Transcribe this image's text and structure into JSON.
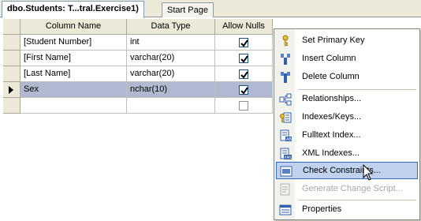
{
  "tabs": [
    {
      "label": "dbo.Students: T...tral.Exercise1)"
    },
    {
      "label": "Start Page"
    }
  ],
  "grid": {
    "headers": {
      "name": "Column Name",
      "type": "Data Type",
      "nulls": "Allow Nulls"
    },
    "rows": [
      {
        "name": "[Student Number]",
        "type": "int",
        "allow_nulls": true
      },
      {
        "name": "[First Name]",
        "type": "varchar(20)",
        "allow_nulls": true
      },
      {
        "name": "[Last Name]",
        "type": "varchar(20)",
        "allow_nulls": true
      },
      {
        "name": "Sex",
        "type": "nchar(10)",
        "allow_nulls": true,
        "selected": true
      },
      {
        "name": "",
        "type": "",
        "allow_nulls": false
      }
    ]
  },
  "menu": {
    "items": [
      {
        "label": "Set Primary Key",
        "icon": "key-icon"
      },
      {
        "label": "Insert Column",
        "icon": "insert-column-icon"
      },
      {
        "label": "Delete Column",
        "icon": "delete-column-icon"
      },
      {
        "label": "Relationships...",
        "icon": "relationships-icon"
      },
      {
        "label": "Indexes/Keys...",
        "icon": "indexes-keys-icon"
      },
      {
        "label": "Fulltext Index...",
        "icon": "fulltext-index-icon"
      },
      {
        "label": "XML Indexes...",
        "icon": "xml-indexes-icon"
      },
      {
        "label": "Check Constraints...",
        "icon": "check-constraints-icon",
        "state": "hover"
      },
      {
        "label": "Generate Change Script...",
        "icon": "generate-script-icon",
        "state": "disabled"
      },
      {
        "label": "Properties",
        "icon": "properties-icon"
      }
    ]
  },
  "colors": {
    "selected_row": "#b0b9cf",
    "menu_hover": "#c1d2ee",
    "menu_hover_border": "#316ac5"
  }
}
